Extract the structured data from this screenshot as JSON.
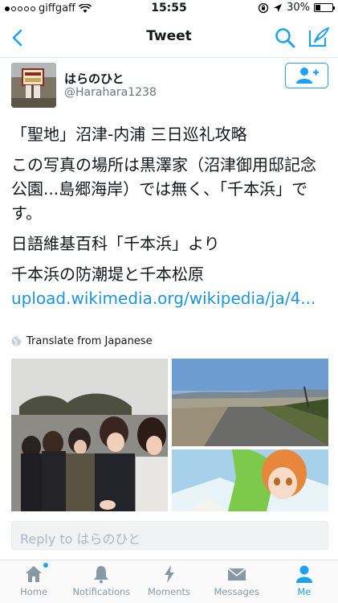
{
  "status_bar": {
    "carrier": "giffgaff",
    "time": "15:55",
    "battery": "30%",
    "battery_level": 0.3
  },
  "nav": {
    "title": "Tweet"
  },
  "author": {
    "display_name": "はらのひと",
    "screen_name": "@Harahara1238"
  },
  "tweet": {
    "lines": [
      "「聖地」沼津-内浦 三日巡礼攻略",
      "この写真の場所は黒澤家（沼津御用邸記念公園...島郷海岸）では無く、「千本浜」です。",
      "日語維基百科「千本浜」より",
      "千本浜の防潮堤と千本松原"
    ],
    "link": "upload.wikimedia.org/wikipedia/ja/4..."
  },
  "translate": {
    "label": "Translate from Japanese"
  },
  "reply": {
    "placeholder": "Reply to はらのひと"
  },
  "tabs": [
    {
      "label": "Home",
      "icon": "home-icon"
    },
    {
      "label": "Notifications",
      "icon": "bell-icon"
    },
    {
      "label": "Moments",
      "icon": "lightning-icon"
    },
    {
      "label": "Messages",
      "icon": "envelope-icon"
    },
    {
      "label": "Me",
      "icon": "person-icon"
    }
  ],
  "colors": {
    "accent": "#1da1f2",
    "link": "#1b95e0",
    "muted": "#8899a6"
  }
}
